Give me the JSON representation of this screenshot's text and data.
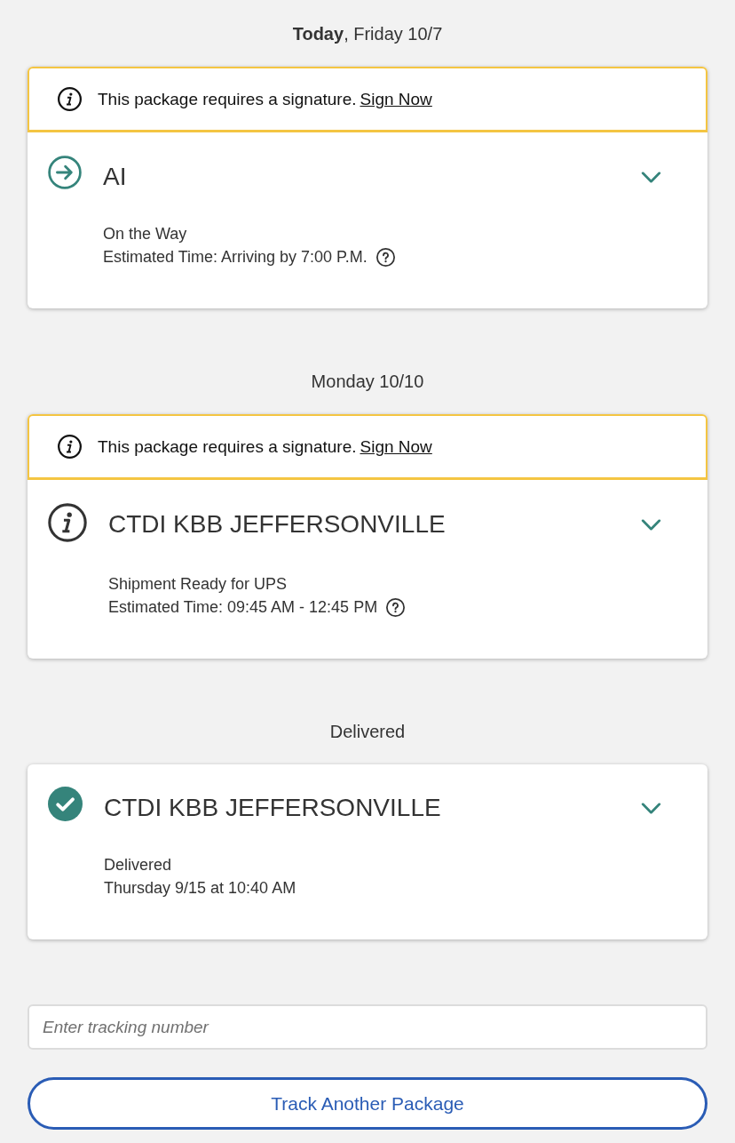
{
  "sections": [
    {
      "heading": "**Today**, Friday 10/7",
      "packages": [
        {
          "alert": {
            "text": "This package requires a signature.",
            "link": "Sign Now"
          },
          "kind": "in_transit",
          "title": "AI",
          "status": "On the Way",
          "detail": "Estimated Time: Arriving by 7:00 P.M.",
          "help": true,
          "expanded": false
        }
      ]
    },
    {
      "heading": "Monday 10/10",
      "packages": [
        {
          "alert": {
            "text": "This package requires a signature.",
            "link": "Sign Now"
          },
          "kind": "info",
          "title": "CTDI KBB JEFFERSONVILLE",
          "status": "Shipment Ready for UPS",
          "detail": "Estimated Time: 09:45 AM - 12:45 PM",
          "help": true,
          "expanded": false
        }
      ]
    },
    {
      "heading": "Delivered",
      "packages": [
        {
          "kind": "delivered",
          "title": "CTDI KBB JEFFERSONVILLE",
          "status": "Delivered",
          "detail": "Thursday 9/15 at 10:40 AM",
          "help": false,
          "expanded": false
        }
      ]
    }
  ],
  "tracking_input": {
    "placeholder": "Enter tracking number"
  },
  "track_button": "Track Another Package"
}
